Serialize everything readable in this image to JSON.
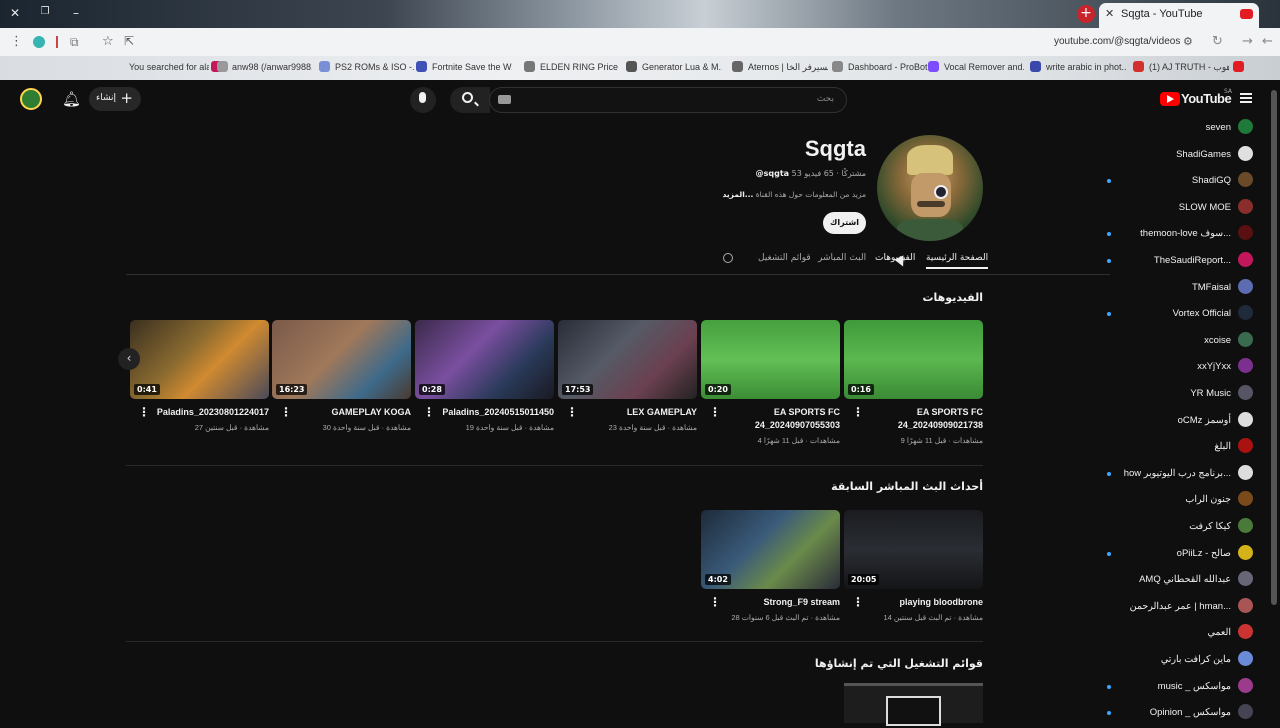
{
  "browser": {
    "tab_title": "Sqgta - YouTube",
    "url": "youtube.com/@sqgta/videos",
    "bookmarks": [
      "You searched for ala...",
      "anw98 (/anwar9988...",
      "PS2 ROMs & ISO -...",
      "Fortnite Save the W...",
      "ELDEN RING Price h...",
      "Generator Lua & M...",
      "Aternos | السيرفر الخا...",
      "Dashboard - ProBot",
      "Vocal Remover and...",
      "write arabic in phot...",
      "(1) AJ TRUTH - ناهوب..."
    ]
  },
  "header": {
    "logo": "YouTube",
    "logo_region": "SA",
    "search_placeholder": "بحث",
    "create_label": "إنشاء"
  },
  "channel": {
    "name": "Sqgta",
    "handle": "@sqgta",
    "stats": "53 مشتركًا · 65 فيديو",
    "about": "مزيد من المعلومات حول هذه القناة",
    "about_more": "...المزيد",
    "subscribe_label": "اشتراك"
  },
  "tabs": [
    "الصفحة الرئيسية",
    "الفيديوهات",
    "البث المباشر",
    "قوائم التشغيل"
  ],
  "sections": {
    "videos_title": "الفيديوهات",
    "live_title": "أحداث البث المباشر السابقة",
    "playlists_title": "قوائم التشغيل التي تم إنشاؤها"
  },
  "videos": [
    {
      "title": "EA SPORTS FC 24_20240909021738",
      "meta": "9 مشاهدات · قبل 11 شهرًا",
      "duration": "0:16"
    },
    {
      "title": "EA SPORTS FC 24_20240907055303",
      "meta": "4 مشاهدات · قبل 11 شهرًا",
      "duration": "0:20"
    },
    {
      "title": "LEX GAMEPLAY",
      "meta": "23 مشاهدة · قبل سنة واحدة",
      "duration": "17:53"
    },
    {
      "title": "Paladins_20240515011450",
      "meta": "19 مشاهدة · قبل سنة واحدة",
      "duration": "0:28"
    },
    {
      "title": "GAMEPLAY KOGA",
      "meta": "30 مشاهدة · قبل سنة واحدة",
      "duration": "16:23"
    },
    {
      "title": "Paladins_20230801224017",
      "meta": "27 مشاهدة · قبل سنتين",
      "duration": "0:41"
    }
  ],
  "live": [
    {
      "title": "playing bloodbrone",
      "meta": "14 مشاهدة · تم البث قبل سنتين",
      "duration": "20:05"
    },
    {
      "title": "Strong_F9 stream",
      "meta": "28 مشاهدة · تم البث قبل 6 سنوات",
      "duration": "4:02"
    }
  ],
  "sidebar": [
    {
      "label": "seven",
      "color": "#1f7a3a",
      "dot": false
    },
    {
      "label": "ShadiGames",
      "color": "#e0e0e0",
      "dot": false
    },
    {
      "label": "ShadiGQ",
      "color": "#6b4a2a",
      "dot": true
    },
    {
      "label": "SLOW MOE",
      "color": "#8a2d2d",
      "dot": false
    },
    {
      "label": "themoon-love سوف...",
      "color": "#5a1010",
      "dot": true
    },
    {
      "label": "TheSaudiReport...",
      "color": "#c2185b",
      "dot": true
    },
    {
      "label": "TMFaisal",
      "color": "#5d6bb0",
      "dot": false
    },
    {
      "label": "Vortex Official",
      "color": "#1f2a3a",
      "dot": true
    },
    {
      "label": "xcoise",
      "color": "#3a6b4f",
      "dot": false
    },
    {
      "label": "xxYjYxx",
      "color": "#7b2f8f",
      "dot": false
    },
    {
      "label": "YR Music",
      "color": "#556",
      "dot": false
    },
    {
      "label": "oCMz أوسمز",
      "color": "#ddd",
      "dot": false
    },
    {
      "label": "البلغ",
      "color": "#a11",
      "dot": false
    },
    {
      "label": "how برنامج درب اليوتيوبر...",
      "color": "#ddd",
      "dot": true
    },
    {
      "label": "جنون الراب",
      "color": "#7a4a1a",
      "dot": false
    },
    {
      "label": "كيكا كرفت",
      "color": "#4a7a3a",
      "dot": false
    },
    {
      "label": "oPiiLz - صالح",
      "color": "#d4b21a",
      "dot": true
    },
    {
      "label": "AMQ عبدالله القحطاني",
      "color": "#667",
      "dot": false
    },
    {
      "label": "عمر عبدالرحمن | hman...",
      "color": "#a55",
      "dot": false
    },
    {
      "label": "العمي",
      "color": "#c33",
      "dot": false
    },
    {
      "label": "ماين كرافت بارتي",
      "color": "#6b8bd6",
      "dot": false
    },
    {
      "label": "music _ مواسكس",
      "color": "#9c3a8c",
      "dot": true
    },
    {
      "label": "Opinion _ مواسكس",
      "color": "#445",
      "dot": true
    }
  ]
}
